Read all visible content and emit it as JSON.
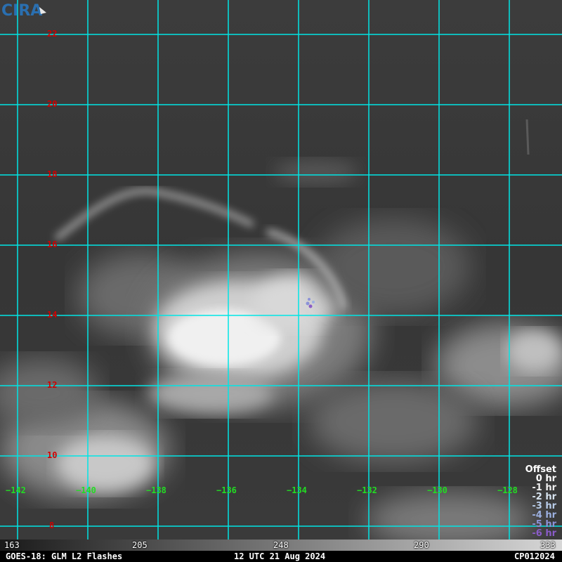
{
  "map": {
    "latitudes": [
      "22",
      "20",
      "18",
      "16",
      "14",
      "12",
      "10",
      "8"
    ],
    "longitudes": [
      "−142",
      "−140",
      "−138",
      "−136",
      "−134",
      "−132",
      "−130",
      "−128"
    ],
    "grid_color": "#00e5e5",
    "lat_label_color": "#d00000",
    "lon_label_color": "#22dd22"
  },
  "legend": {
    "title": "Offset",
    "items": [
      {
        "label": "0 hr",
        "color": "#ffffff"
      },
      {
        "label": "-1 hr",
        "color": "#f0f0f0"
      },
      {
        "label": "-2 hr",
        "color": "#d8e4f0"
      },
      {
        "label": "-3 hr",
        "color": "#b8cce8"
      },
      {
        "label": "-4 hr",
        "color": "#9cb0e0"
      },
      {
        "label": "-5 hr",
        "color": "#8c92d8"
      },
      {
        "label": "-6 hr",
        "color": "#8a5cc8"
      }
    ]
  },
  "logo_text": "CIRA",
  "scale": {
    "ticks": [
      "163",
      "205",
      "248",
      "290",
      "333"
    ]
  },
  "footer": {
    "left": "GOES-18: GLM L2 Flashes",
    "center": "12 UTC 21 Aug 2024",
    "right": "CP012024"
  }
}
